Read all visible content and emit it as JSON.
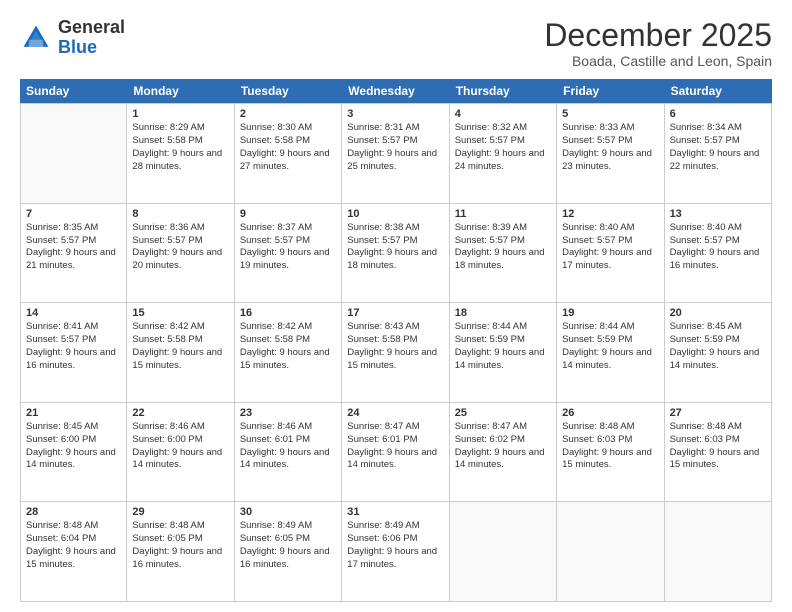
{
  "logo": {
    "general": "General",
    "blue": "Blue"
  },
  "title": "December 2025",
  "subtitle": "Boada, Castille and Leon, Spain",
  "header_days": [
    "Sunday",
    "Monday",
    "Tuesday",
    "Wednesday",
    "Thursday",
    "Friday",
    "Saturday"
  ],
  "weeks": [
    [
      {
        "day": "",
        "sunrise": "",
        "sunset": "",
        "daylight": "",
        "empty": true
      },
      {
        "day": "1",
        "sunrise": "Sunrise: 8:29 AM",
        "sunset": "Sunset: 5:58 PM",
        "daylight": "Daylight: 9 hours and 28 minutes."
      },
      {
        "day": "2",
        "sunrise": "Sunrise: 8:30 AM",
        "sunset": "Sunset: 5:58 PM",
        "daylight": "Daylight: 9 hours and 27 minutes."
      },
      {
        "day": "3",
        "sunrise": "Sunrise: 8:31 AM",
        "sunset": "Sunset: 5:57 PM",
        "daylight": "Daylight: 9 hours and 25 minutes."
      },
      {
        "day": "4",
        "sunrise": "Sunrise: 8:32 AM",
        "sunset": "Sunset: 5:57 PM",
        "daylight": "Daylight: 9 hours and 24 minutes."
      },
      {
        "day": "5",
        "sunrise": "Sunrise: 8:33 AM",
        "sunset": "Sunset: 5:57 PM",
        "daylight": "Daylight: 9 hours and 23 minutes."
      },
      {
        "day": "6",
        "sunrise": "Sunrise: 8:34 AM",
        "sunset": "Sunset: 5:57 PM",
        "daylight": "Daylight: 9 hours and 22 minutes."
      }
    ],
    [
      {
        "day": "7",
        "sunrise": "Sunrise: 8:35 AM",
        "sunset": "Sunset: 5:57 PM",
        "daylight": "Daylight: 9 hours and 21 minutes."
      },
      {
        "day": "8",
        "sunrise": "Sunrise: 8:36 AM",
        "sunset": "Sunset: 5:57 PM",
        "daylight": "Daylight: 9 hours and 20 minutes."
      },
      {
        "day": "9",
        "sunrise": "Sunrise: 8:37 AM",
        "sunset": "Sunset: 5:57 PM",
        "daylight": "Daylight: 9 hours and 19 minutes."
      },
      {
        "day": "10",
        "sunrise": "Sunrise: 8:38 AM",
        "sunset": "Sunset: 5:57 PM",
        "daylight": "Daylight: 9 hours and 18 minutes."
      },
      {
        "day": "11",
        "sunrise": "Sunrise: 8:39 AM",
        "sunset": "Sunset: 5:57 PM",
        "daylight": "Daylight: 9 hours and 18 minutes."
      },
      {
        "day": "12",
        "sunrise": "Sunrise: 8:40 AM",
        "sunset": "Sunset: 5:57 PM",
        "daylight": "Daylight: 9 hours and 17 minutes."
      },
      {
        "day": "13",
        "sunrise": "Sunrise: 8:40 AM",
        "sunset": "Sunset: 5:57 PM",
        "daylight": "Daylight: 9 hours and 16 minutes."
      }
    ],
    [
      {
        "day": "14",
        "sunrise": "Sunrise: 8:41 AM",
        "sunset": "Sunset: 5:57 PM",
        "daylight": "Daylight: 9 hours and 16 minutes."
      },
      {
        "day": "15",
        "sunrise": "Sunrise: 8:42 AM",
        "sunset": "Sunset: 5:58 PM",
        "daylight": "Daylight: 9 hours and 15 minutes."
      },
      {
        "day": "16",
        "sunrise": "Sunrise: 8:42 AM",
        "sunset": "Sunset: 5:58 PM",
        "daylight": "Daylight: 9 hours and 15 minutes."
      },
      {
        "day": "17",
        "sunrise": "Sunrise: 8:43 AM",
        "sunset": "Sunset: 5:58 PM",
        "daylight": "Daylight: 9 hours and 15 minutes."
      },
      {
        "day": "18",
        "sunrise": "Sunrise: 8:44 AM",
        "sunset": "Sunset: 5:59 PM",
        "daylight": "Daylight: 9 hours and 14 minutes."
      },
      {
        "day": "19",
        "sunrise": "Sunrise: 8:44 AM",
        "sunset": "Sunset: 5:59 PM",
        "daylight": "Daylight: 9 hours and 14 minutes."
      },
      {
        "day": "20",
        "sunrise": "Sunrise: 8:45 AM",
        "sunset": "Sunset: 5:59 PM",
        "daylight": "Daylight: 9 hours and 14 minutes."
      }
    ],
    [
      {
        "day": "21",
        "sunrise": "Sunrise: 8:45 AM",
        "sunset": "Sunset: 6:00 PM",
        "daylight": "Daylight: 9 hours and 14 minutes."
      },
      {
        "day": "22",
        "sunrise": "Sunrise: 8:46 AM",
        "sunset": "Sunset: 6:00 PM",
        "daylight": "Daylight: 9 hours and 14 minutes."
      },
      {
        "day": "23",
        "sunrise": "Sunrise: 8:46 AM",
        "sunset": "Sunset: 6:01 PM",
        "daylight": "Daylight: 9 hours and 14 minutes."
      },
      {
        "day": "24",
        "sunrise": "Sunrise: 8:47 AM",
        "sunset": "Sunset: 6:01 PM",
        "daylight": "Daylight: 9 hours and 14 minutes."
      },
      {
        "day": "25",
        "sunrise": "Sunrise: 8:47 AM",
        "sunset": "Sunset: 6:02 PM",
        "daylight": "Daylight: 9 hours and 14 minutes."
      },
      {
        "day": "26",
        "sunrise": "Sunrise: 8:48 AM",
        "sunset": "Sunset: 6:03 PM",
        "daylight": "Daylight: 9 hours and 15 minutes."
      },
      {
        "day": "27",
        "sunrise": "Sunrise: 8:48 AM",
        "sunset": "Sunset: 6:03 PM",
        "daylight": "Daylight: 9 hours and 15 minutes."
      }
    ],
    [
      {
        "day": "28",
        "sunrise": "Sunrise: 8:48 AM",
        "sunset": "Sunset: 6:04 PM",
        "daylight": "Daylight: 9 hours and 15 minutes."
      },
      {
        "day": "29",
        "sunrise": "Sunrise: 8:48 AM",
        "sunset": "Sunset: 6:05 PM",
        "daylight": "Daylight: 9 hours and 16 minutes."
      },
      {
        "day": "30",
        "sunrise": "Sunrise: 8:49 AM",
        "sunset": "Sunset: 6:05 PM",
        "daylight": "Daylight: 9 hours and 16 minutes."
      },
      {
        "day": "31",
        "sunrise": "Sunrise: 8:49 AM",
        "sunset": "Sunset: 6:06 PM",
        "daylight": "Daylight: 9 hours and 17 minutes."
      },
      {
        "day": "",
        "sunrise": "",
        "sunset": "",
        "daylight": "",
        "empty": true
      },
      {
        "day": "",
        "sunrise": "",
        "sunset": "",
        "daylight": "",
        "empty": true
      },
      {
        "day": "",
        "sunrise": "",
        "sunset": "",
        "daylight": "",
        "empty": true
      }
    ]
  ]
}
